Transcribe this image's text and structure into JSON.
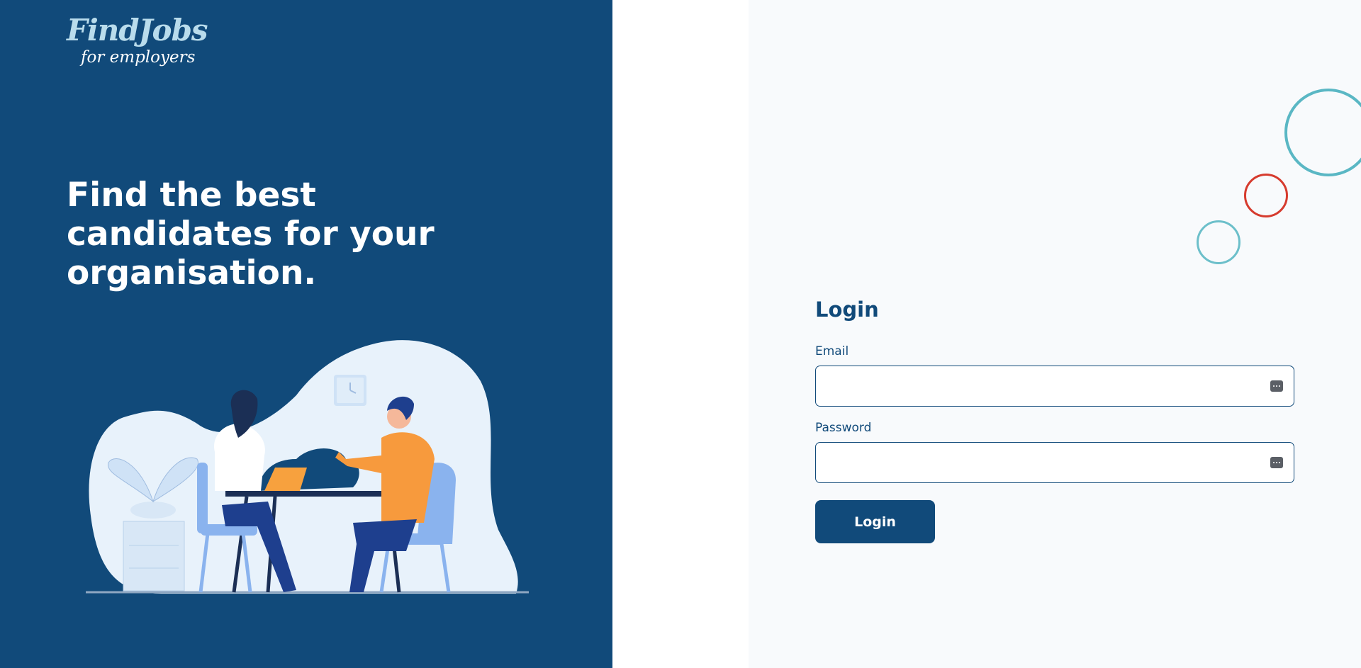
{
  "brand": {
    "logo_main": "FindJobs",
    "logo_sub": "for employers",
    "colors": {
      "primary": "#114a7a",
      "logo_accent": "#b9dcec",
      "deco_teal": "#5ab7c4",
      "deco_red": "#d63b2e"
    }
  },
  "hero": {
    "title": "Find the best candidates for your organisation."
  },
  "illustration": {
    "icon": "interview-illustration"
  },
  "login": {
    "title": "Login",
    "email_label": "Email",
    "email_value": "",
    "password_label": "Password",
    "password_value": "",
    "button_label": "Login",
    "field_icon": "password-manager-key-icon"
  }
}
